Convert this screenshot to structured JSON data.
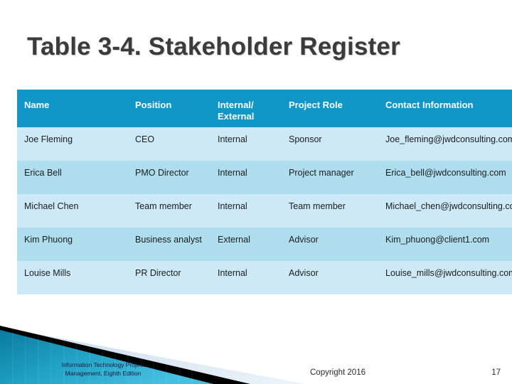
{
  "slide": {
    "title": "Table 3-4. Stakeholder Register"
  },
  "colors": {
    "header_bg": "#1196c8",
    "row_light_bg": "#cde8f6",
    "row_dark_bg": "#aeddee",
    "title_text": "#3b3b3b",
    "band_teal_dark": "#0a7a9e",
    "band_teal_light": "#45bfe0",
    "band_black": "#000000",
    "band_pale": "#d6e4ee"
  },
  "table": {
    "columns": [
      "Name",
      "Position",
      "Internal/ External",
      "Project Role",
      "Contact Information"
    ],
    "rows": [
      {
        "name": "Joe Fleming",
        "position": "CEO",
        "internal_external": "Internal",
        "project_role": "Sponsor",
        "contact": "Joe_fleming@jwdconsulting.com"
      },
      {
        "name": "Erica Bell",
        "position": "PMO Director",
        "internal_external": "Internal",
        "project_role": "Project manager",
        "contact": "Erica_bell@jwdconsulting.com"
      },
      {
        "name": "Michael Chen",
        "position": "Team member",
        "internal_external": "Internal",
        "project_role": "Team member",
        "contact": "Michael_chen@jwdconsulting.com"
      },
      {
        "name": "Kim Phuong",
        "position": "Business analyst",
        "internal_external": "External",
        "project_role": "Advisor",
        "contact": "Kim_phuong@client1.com"
      },
      {
        "name": "Louise Mills",
        "position": "PR Director",
        "internal_external": "Internal",
        "project_role": "Advisor",
        "contact": "Louise_mills@jwdconsulting.com"
      }
    ]
  },
  "footer": {
    "book_title_line1": "Information Technology Project",
    "book_title_line2": "Management, Eighth Edition",
    "copyright": "Copyright 2016",
    "page_number": "17"
  }
}
